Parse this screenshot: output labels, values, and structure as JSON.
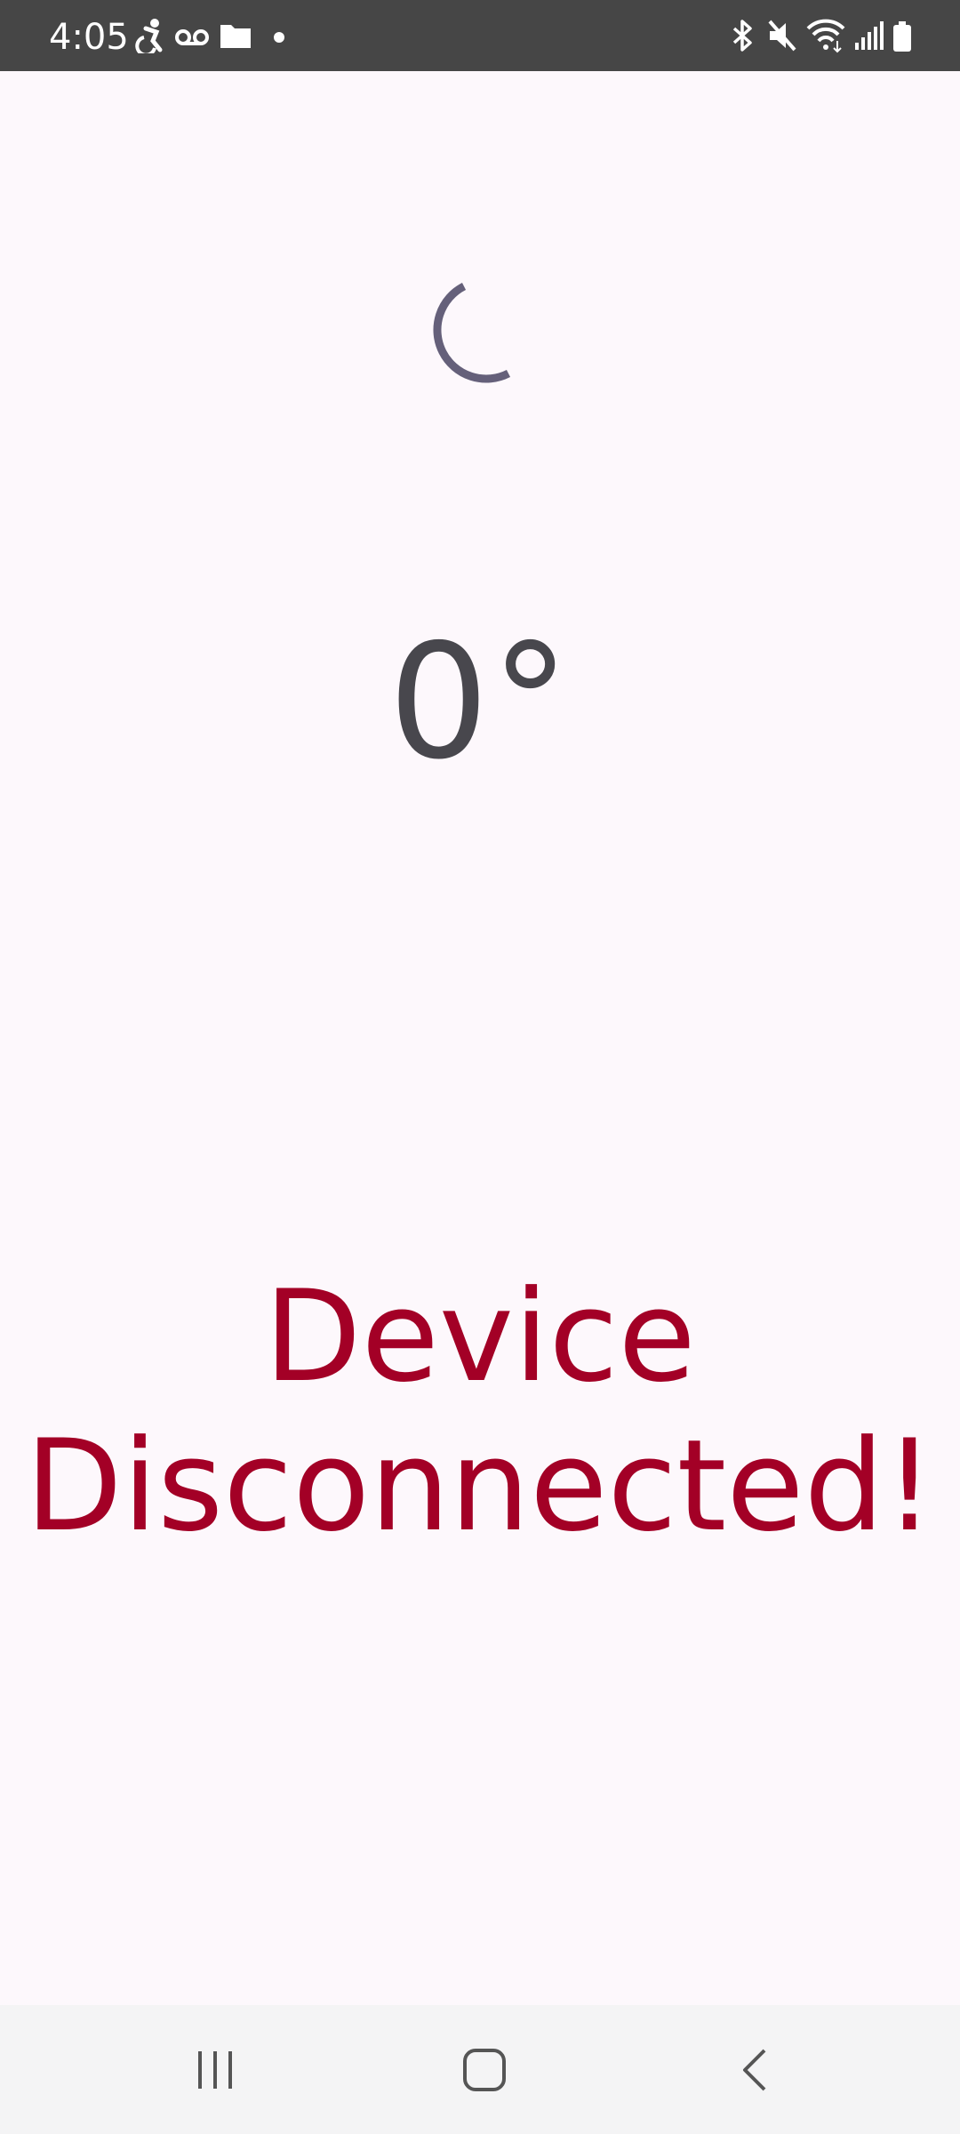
{
  "status_bar": {
    "time": "4:05",
    "left_icons": [
      "accessibility-icon",
      "voicemail-icon",
      "folder-icon",
      "notification-dot-icon"
    ],
    "right_icons": [
      "bluetooth-icon",
      "mute-icon",
      "wifi-icon",
      "signal-icon",
      "battery-icon"
    ]
  },
  "main": {
    "loading_indicator": "spinner-icon",
    "temperature": "0°",
    "status_line1": "Device",
    "status_line2": "Disconnected!"
  },
  "colors": {
    "status_bar_bg": "#464646",
    "background": "#fdf8fc",
    "temperature_text": "#48474d",
    "spinner": "#65607a",
    "error_text": "#a30026",
    "nav_bar_bg": "#f4f4f5"
  },
  "nav_bar": {
    "buttons": [
      "recent-apps-icon",
      "home-icon",
      "back-icon"
    ]
  }
}
